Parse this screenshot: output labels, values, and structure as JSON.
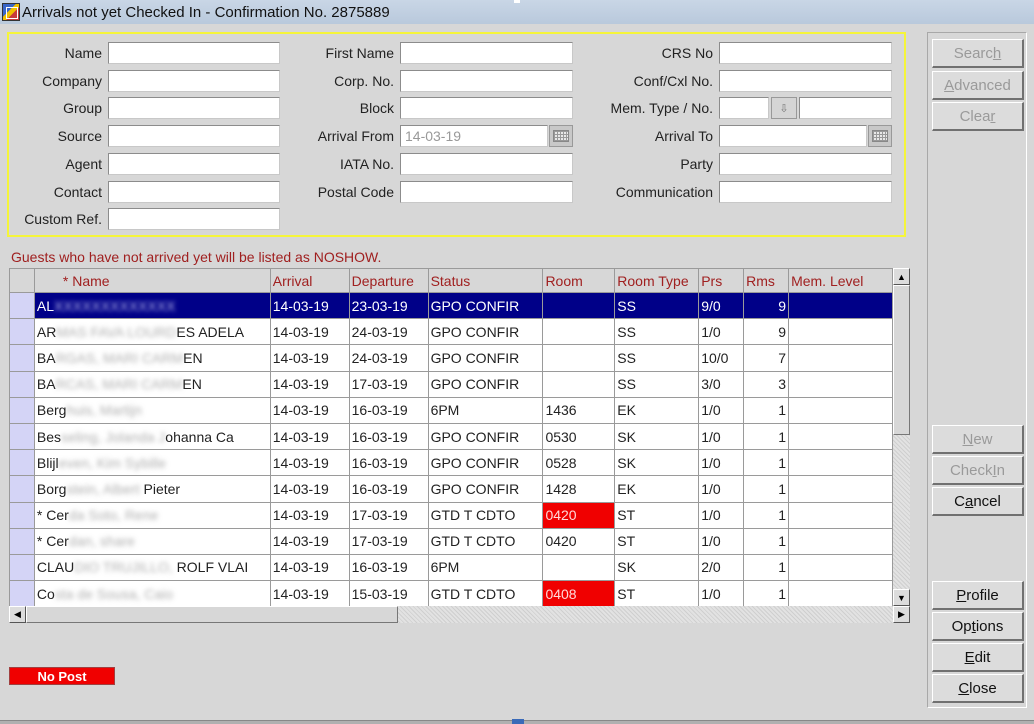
{
  "window": {
    "title": "Arrivals not yet Checked In - Confirmation No.  2875889"
  },
  "search": {
    "col1": [
      {
        "label": "Name",
        "value": ""
      },
      {
        "label": "Company",
        "value": ""
      },
      {
        "label": "Group",
        "value": ""
      },
      {
        "label": "Source",
        "value": ""
      },
      {
        "label": "Agent",
        "value": ""
      },
      {
        "label": "Contact",
        "value": ""
      },
      {
        "label": "Custom Ref.",
        "value": ""
      }
    ],
    "col2": [
      {
        "label": "First Name",
        "value": ""
      },
      {
        "label": "Corp. No.",
        "value": ""
      },
      {
        "label": "Block",
        "value": ""
      },
      {
        "label": "Arrival From",
        "value": "14-03-19"
      },
      {
        "label": "IATA No.",
        "value": ""
      },
      {
        "label": "Postal Code",
        "value": ""
      }
    ],
    "col3": [
      {
        "label": "CRS No",
        "value": ""
      },
      {
        "label": "Conf/Cxl No.",
        "value": ""
      },
      {
        "label": "Mem. Type / No.",
        "value": "",
        "value2": ""
      },
      {
        "label": "Arrival To",
        "value": ""
      },
      {
        "label": "Party",
        "value": ""
      },
      {
        "label": "Communication",
        "value": ""
      }
    ]
  },
  "buttons": {
    "search": {
      "pre": "Searc",
      "ul": "h",
      "post": ""
    },
    "advanced": {
      "pre": "",
      "ul": "A",
      "post": "dvanced"
    },
    "clear": {
      "pre": "Clea",
      "ul": "r",
      "post": ""
    },
    "new": {
      "pre": "",
      "ul": "N",
      "post": "ew"
    },
    "checkin": {
      "pre": "Check ",
      "ul": "I",
      "post": "n"
    },
    "cancel": {
      "pre": "C",
      "ul": "a",
      "post": "ncel"
    },
    "profile": {
      "pre": "",
      "ul": "P",
      "post": "rofile"
    },
    "options": {
      "pre": "Op",
      "ul": "t",
      "post": "ions"
    },
    "edit": {
      "pre": "",
      "ul": "E",
      "post": "dit"
    },
    "close": {
      "pre": "",
      "ul": "C",
      "post": "lose"
    }
  },
  "notice": "Guests who have not arrived yet will be listed as NOSHOW.",
  "grid": {
    "headers": [
      "* Name",
      "Arrival",
      "Departure",
      "Status",
      "Room",
      "Room Type",
      "Prs",
      "Rms",
      "Mem. Level"
    ],
    "rows": [
      {
        "marker": "",
        "name_visible": "AL",
        "name_hidden": "XXXXXXXXXXXXX",
        "arrival": "14-03-19",
        "departure": "23-03-19",
        "status": "GPO CONFIR",
        "room": "",
        "room_red": false,
        "room_type": "SS",
        "prs": "9/0",
        "rms": "9",
        "mem": "",
        "selected": true
      },
      {
        "marker": "",
        "name_visible": "AR",
        "name_hidden": "MAS FAVA LOURD",
        "name_tail": "ES ADELA",
        "arrival": "14-03-19",
        "departure": "24-03-19",
        "status": "GPO CONFIR",
        "room": "",
        "room_red": false,
        "room_type": "SS",
        "prs": "1/0",
        "rms": "9",
        "mem": ""
      },
      {
        "marker": "",
        "name_visible": "BA",
        "name_hidden": "RGAS, MARI CARM",
        "name_tail": "EN",
        "arrival": "14-03-19",
        "departure": "24-03-19",
        "status": "GPO CONFIR",
        "room": "",
        "room_red": false,
        "room_type": "SS",
        "prs": "10/0",
        "rms": "7",
        "mem": ""
      },
      {
        "marker": "",
        "name_visible": "BA",
        "name_hidden": "RCAS, MARI CARM",
        "name_tail": "EN",
        "arrival": "14-03-19",
        "departure": "17-03-19",
        "status": "GPO CONFIR",
        "room": "",
        "room_red": false,
        "room_type": "SS",
        "prs": "3/0",
        "rms": "3",
        "mem": ""
      },
      {
        "marker": "",
        "name_visible": "Berg",
        "name_hidden": "huis, Martijn",
        "name_tail": "",
        "arrival": "14-03-19",
        "departure": "16-03-19",
        "status": "6PM",
        "room": "1436",
        "room_red": false,
        "room_type": "EK",
        "prs": "1/0",
        "rms": "1",
        "mem": ""
      },
      {
        "marker": "",
        "name_visible": "Bes",
        "name_hidden": "seling, Jolanda J",
        "name_tail": "ohanna Ca",
        "arrival": "14-03-19",
        "departure": "16-03-19",
        "status": "GPO CONFIR",
        "room": "0530",
        "room_red": false,
        "room_type": "SK",
        "prs": "1/0",
        "rms": "1",
        "mem": ""
      },
      {
        "marker": "",
        "name_visible": "Blijl",
        "name_hidden": "even, Kim Sybille",
        "name_tail": "",
        "arrival": "14-03-19",
        "departure": "16-03-19",
        "status": "GPO CONFIR",
        "room": "0528",
        "room_red": false,
        "room_type": "SK",
        "prs": "1/0",
        "rms": "1",
        "mem": ""
      },
      {
        "marker": "",
        "name_visible": "Borg",
        "name_hidden": "stein, Albert",
        "name_tail": " Pieter",
        "arrival": "14-03-19",
        "departure": "16-03-19",
        "status": "GPO CONFIR",
        "room": "1428",
        "room_red": false,
        "room_type": "EK",
        "prs": "1/0",
        "rms": "1",
        "mem": ""
      },
      {
        "marker": "* ",
        "name_visible": "Cer",
        "name_hidden": "da Soto, Rene",
        "name_tail": "",
        "arrival": "14-03-19",
        "departure": "17-03-19",
        "status": "GTD T CDTO",
        "room": "0420",
        "room_red": true,
        "room_type": "ST",
        "prs": "1/0",
        "rms": "1",
        "mem": ""
      },
      {
        "marker": "* ",
        "name_visible": "Cer",
        "name_hidden": "dan, share",
        "name_tail": "",
        "arrival": "14-03-19",
        "departure": "17-03-19",
        "status": "GTD T CDTO",
        "room": "0420",
        "room_red": false,
        "room_type": "ST",
        "prs": "1/0",
        "rms": "1",
        "mem": ""
      },
      {
        "marker": "",
        "name_visible": "CLAU",
        "name_hidden": "DIO TRUJILLO,",
        "name_tail": " ROLF VLAI",
        "arrival": "14-03-19",
        "departure": "16-03-19",
        "status": "6PM",
        "room": "",
        "room_red": false,
        "room_type": "SK",
        "prs": "2/0",
        "rms": "1",
        "mem": ""
      },
      {
        "marker": "",
        "name_visible": "Co",
        "name_hidden": "sta de Sousa, Caio",
        "name_tail": "",
        "arrival": "14-03-19",
        "departure": "15-03-19",
        "status": "GTD T CDTO",
        "room": "0408",
        "room_red": true,
        "room_type": "ST",
        "prs": "1/0",
        "rms": "1",
        "mem": ""
      }
    ]
  },
  "status_badge": "No Post",
  "colors": {
    "highlight_border": "#f5f53a",
    "selected_row": "#000088",
    "alert_red": "#f00000",
    "header_text": "#a02020"
  }
}
